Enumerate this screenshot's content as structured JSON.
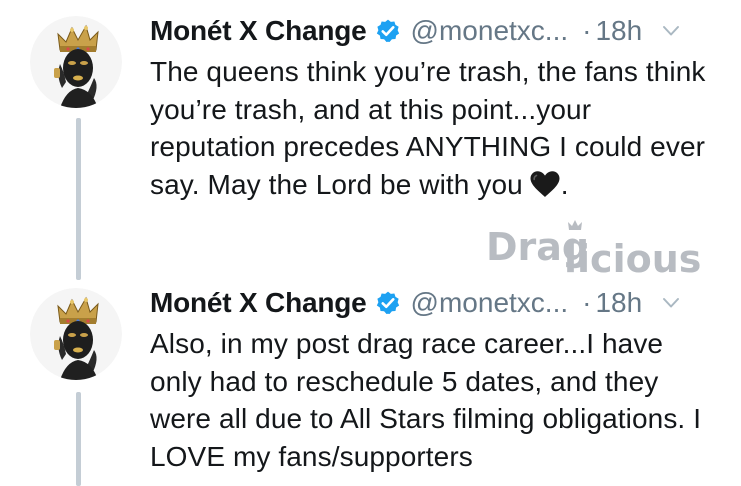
{
  "tweets": [
    {
      "display_name": "Monét X Change",
      "handle": "@monetxc...",
      "separator": "·",
      "time": "18h",
      "text": "The queens think you’re trash, the fans think you’re trash, and at this point...your reputation precedes ANYTHING I could ever say. May the Lord be with you",
      "trailing_emoji": "black-heart",
      "trailing_text": "."
    },
    {
      "display_name": "Monét X Change",
      "handle": "@monetxc...",
      "separator": "·",
      "time": "18h",
      "text": "Also, in my post drag race career...I have only had to reschedule 5 dates, and they were all due to All Stars filming obligations. I LOVE my fans/supporters"
    }
  ],
  "watermark": {
    "text_part1": "Drag",
    "text_part2": "licious"
  },
  "colors": {
    "text": "#14171a",
    "secondary": "#657786",
    "verified": "#1da1f2",
    "thread_line": "#c4cdd5",
    "watermark": "#b8bcc2"
  },
  "icons": [
    "verified-badge-icon",
    "chevron-down-icon",
    "black-heart-icon",
    "crown-icon"
  ]
}
